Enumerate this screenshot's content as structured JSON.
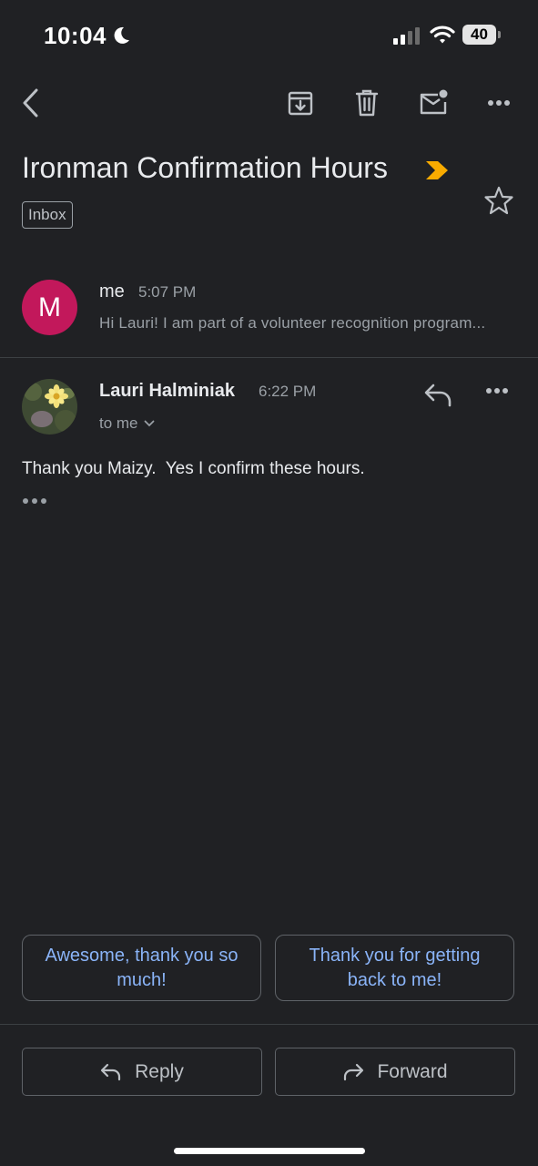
{
  "status_bar": {
    "time": "10:04",
    "battery": "40"
  },
  "toolbar": {
    "back_icon": "chevron-left-icon",
    "archive_icon": "archive-icon",
    "delete_icon": "trash-icon",
    "unread_icon": "mark-unread-icon",
    "more_icon": "more-horizontal-icon"
  },
  "subject": {
    "title": "Ironman Confirmation Hours",
    "label": "Inbox"
  },
  "messages": [
    {
      "avatar_letter": "M",
      "avatar_color": "#c2185b",
      "sender": "me",
      "time": "5:07 PM",
      "snippet": "Hi Lauri! I am part of a volunteer recognition program..."
    },
    {
      "sender": "Lauri Halminiak",
      "time": "6:22 PM",
      "recipient": "to me",
      "body": "Thank you Maizy.  Yes I confirm these hours."
    }
  ],
  "smart_replies": [
    "Awesome, thank you so much!",
    "Thank you for getting back to me!"
  ],
  "actions": {
    "reply": "Reply",
    "forward": "Forward"
  },
  "colors": {
    "background": "#202124",
    "accent_link": "#8ab4f8",
    "importance": "#f9ab00"
  }
}
